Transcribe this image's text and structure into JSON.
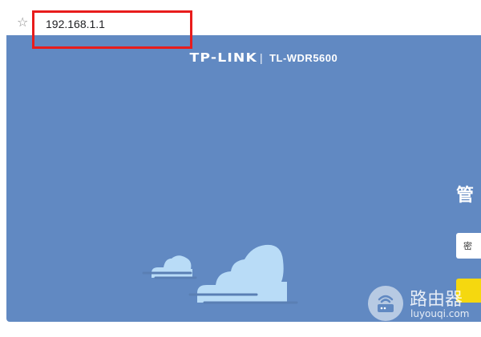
{
  "browser": {
    "url": "192.168.1.1",
    "bookmark_icon": "star-outline-icon"
  },
  "router_page": {
    "brand": "TP-LINK",
    "separator": "|",
    "model": "TL-WDR5600",
    "login_title_partial": "管",
    "password_placeholder_partial": "密",
    "colors": {
      "background": "#6189c2",
      "cloud": "#b9dcf7",
      "login_button": "#f5d80f",
      "highlight": "#e81c1c"
    }
  },
  "watermark": {
    "title": "路由器",
    "domain": "luyouqi.com",
    "icon": "router-icon"
  }
}
